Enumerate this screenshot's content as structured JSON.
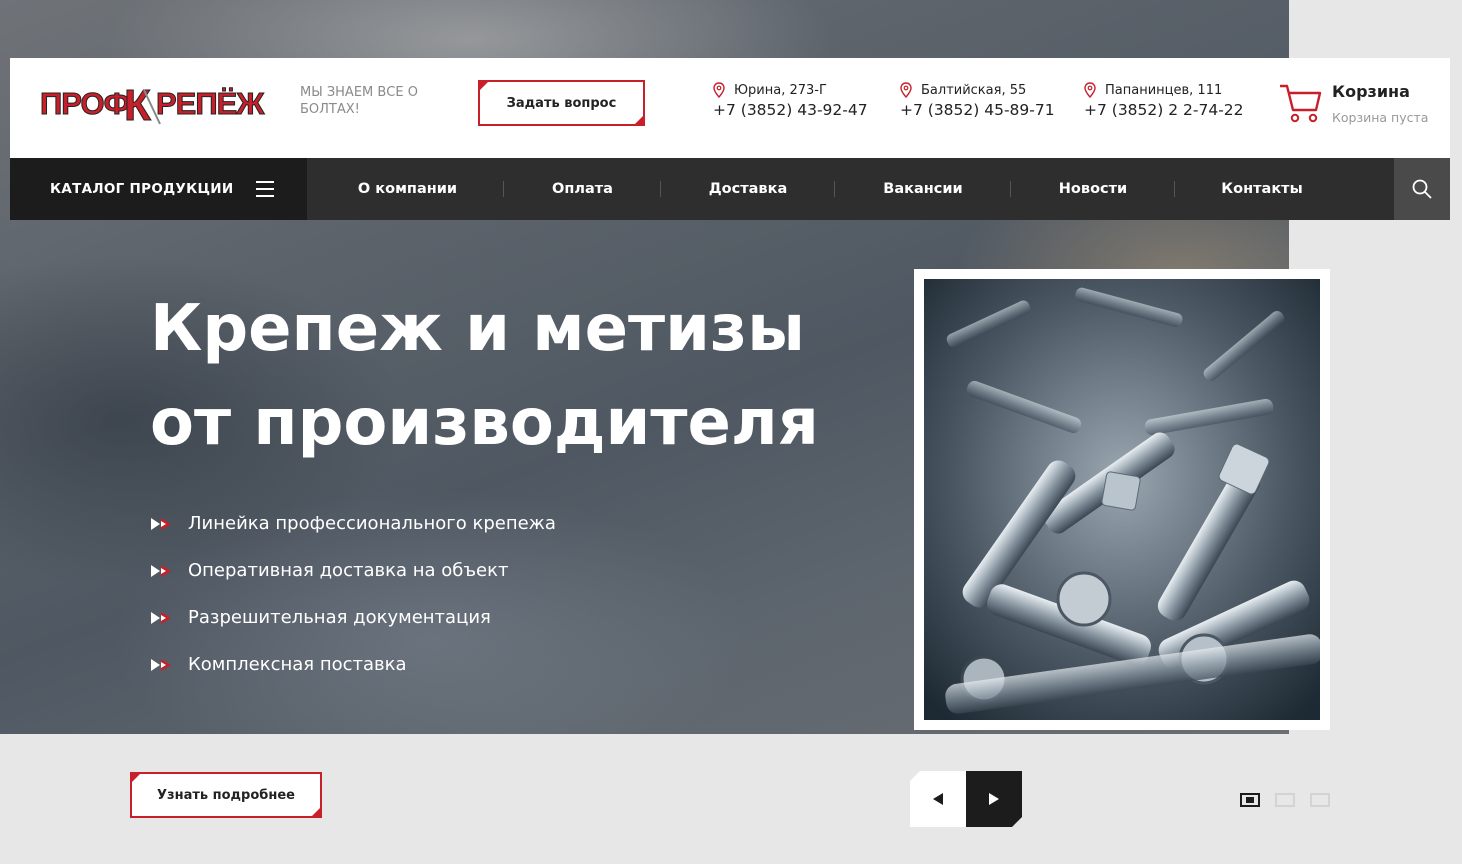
{
  "brand": {
    "logo_text": "ПРОФКРЕПЁЖ",
    "tagline": "МЫ ЗНАЕМ ВСЕ О БОЛТАХ!"
  },
  "header": {
    "ask_button": "Задать вопрос",
    "addresses": [
      {
        "address": "Юрина, 273-Г",
        "phone": "+7 (3852) 43-92-47"
      },
      {
        "address": "Балтийская, 55",
        "phone": "+7 (3852) 45-89-71"
      },
      {
        "address": "Папанинцев, 111",
        "phone": "+7 (3852) 2 2-74-22"
      }
    ],
    "cart": {
      "title": "Корзина",
      "status": "Корзина пуста"
    }
  },
  "nav": {
    "catalog_label": "КАТАЛОГ ПРОДУКЦИИ",
    "items": [
      "О компании",
      "Оплата",
      "Доставка",
      "Вакансии",
      "Новости",
      "Контакты"
    ]
  },
  "hero": {
    "title_line1": "Крепеж и метизы",
    "title_line2": "от производителя",
    "features": [
      "Линейка профессионального крепежа",
      "Оперативная доставка на объект",
      "Разрешительная документация",
      "Комплексная поставка"
    ],
    "more_button": "Узнать подробнее"
  },
  "slider": {
    "slide_count": 3,
    "active_index": 0
  },
  "colors": {
    "accent": "#c8202a",
    "dark": "#1c1c1c",
    "nav_bg": "#2e2e2e"
  },
  "icons": {
    "address": "map-pin-icon",
    "cart": "shopping-cart-icon",
    "search": "search-icon",
    "menu": "hamburger-menu-icon",
    "feature": "double-arrow-icon",
    "prev": "arrow-left-icon",
    "next": "arrow-right-icon"
  }
}
